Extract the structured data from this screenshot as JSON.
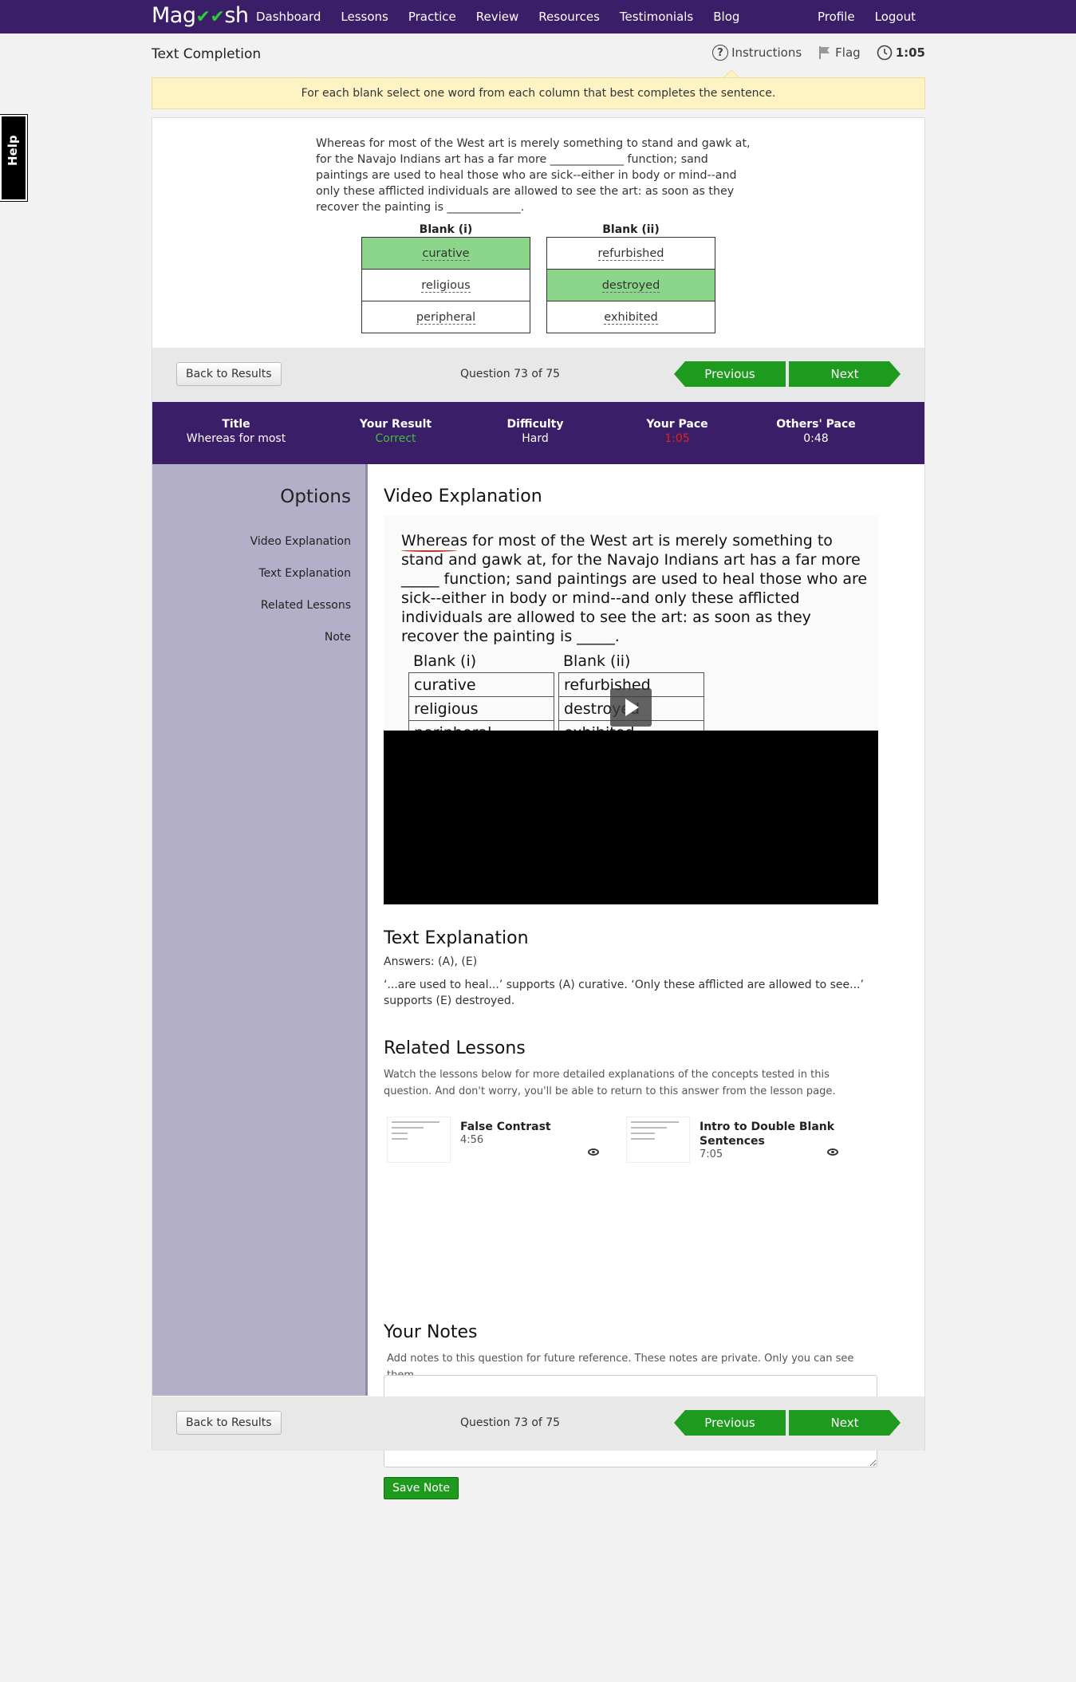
{
  "brand": {
    "logo_text_1": "Mag",
    "logo_check": "✔✔",
    "logo_text_2": "sh"
  },
  "nav": {
    "links": [
      "Dashboard",
      "Lessons",
      "Practice",
      "Review",
      "Resources",
      "Testimonials",
      "Blog"
    ],
    "right": [
      "Profile",
      "Logout"
    ]
  },
  "help_tab": "Help",
  "header": {
    "title": "Text Completion",
    "instructions_label": "Instructions",
    "flag_label": "Flag",
    "timer": "1:05",
    "instruction_text": "For each blank select one word from each column that best completes the sentence."
  },
  "question": {
    "text": "Whereas for most of the West art is merely something to stand and gawk at, for the Navajo Indians art has a far more _____________ function; sand paintings are used to heal those who are sick--either in body or mind--and only these afflicted individuals are allowed to see the art: as soon as they recover the painting is _____________.",
    "blank1": {
      "header": "Blank (i)",
      "options": [
        "curative",
        "religious",
        "peripheral"
      ],
      "selected": 0
    },
    "blank2": {
      "header": "Blank (ii)",
      "options": [
        "refurbished",
        "destroyed",
        "exhibited"
      ],
      "selected": 1
    }
  },
  "navigation": {
    "back_label": "Back to Results",
    "counter": "Question 73 of 75",
    "previous_label": "Previous",
    "next_label": "Next"
  },
  "stats": {
    "title_label": "Title",
    "title_value": "Whereas for most",
    "result_label": "Your Result",
    "result_value": "Correct",
    "difficulty_label": "Difficulty",
    "difficulty_value": "Hard",
    "pace_label": "Your Pace",
    "pace_value": "1:05",
    "others_label": "Others' Pace",
    "others_value": "0:48"
  },
  "options": {
    "title": "Options",
    "items": [
      "Video Explanation",
      "Text Explanation",
      "Related Lessons",
      "Note"
    ]
  },
  "video": {
    "heading": "Video Explanation",
    "frame_text": "Whereas for most of the West art is merely something to stand and gawk at, for the Navajo Indians art has a far more _____ function; sand paintings are used to heal those who are sick--either in body or mind--and only these afflicted individuals are allowed to see the art: as soon as they recover the painting is _____.",
    "blank1": "Blank (i)",
    "blank2": "Blank (ii)",
    "col1": [
      "curative",
      "religious",
      "peripheral"
    ],
    "col2": [
      "refurbished",
      "destroyed",
      "exhibited"
    ]
  },
  "text_explanation": {
    "heading": "Text Explanation",
    "answers": "Answers: (A), (E)",
    "body": "‘...are used to heal...’ supports (A) curative. ‘Only these afflicted are allowed to see...’ supports (E) destroyed."
  },
  "related": {
    "heading": "Related Lessons",
    "intro": "Watch the lessons below for more detailed explanations of the concepts tested in this question. And don't worry, you'll be able to return to this answer from the lesson page.",
    "lessons": [
      {
        "name": "False Contrast",
        "duration": "4:56"
      },
      {
        "name": "Intro to Double Blank Sentences",
        "duration": "7:05"
      }
    ]
  },
  "notes": {
    "heading": "Your Notes",
    "intro": "Add notes to this question for future reference. These notes are private. Only you can see them.",
    "save_label": "Save Note"
  }
}
